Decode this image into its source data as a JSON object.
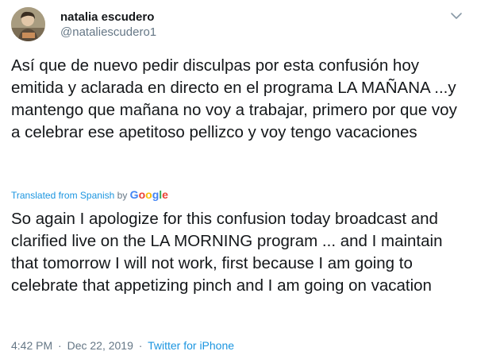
{
  "author": {
    "name": "natalia escudero",
    "handle": "@nataliescudero1",
    "avatar_icon": "profile-photo"
  },
  "menu_icon": "chevron-down-icon",
  "tweet": {
    "text": "Así que de nuevo pedir disculpas por esta confusión hoy emitida y aclarada en directo en el programa LA MAÑANA ...y mantengo que mañana no voy a trabajar, primero por que voy a celebrar ese apetitoso pellizco y voy tengo vacaciones"
  },
  "translation": {
    "label": "Translated from Spanish",
    "by": "by",
    "provider": "Google",
    "text": "So again I apologize for this confusion today broadcast and clarified live on the LA MORNING program ... and I maintain that tomorrow I will not work, first because I am going to celebrate that appetizing pinch and I am going on vacation"
  },
  "meta": {
    "time": "4:42 PM",
    "separator": "·",
    "date": "Dec 22, 2019",
    "source": "Twitter for iPhone"
  },
  "colors": {
    "link": "#1b95e0",
    "secondary_text": "#657786",
    "primary_text": "#14171a"
  }
}
